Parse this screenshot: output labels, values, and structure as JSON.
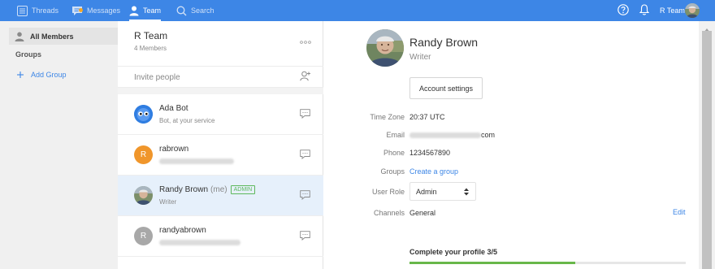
{
  "topbar": {
    "nav": [
      {
        "label": "Threads",
        "icon": "threads-icon"
      },
      {
        "label": "Messages",
        "icon": "messages-icon",
        "has_notification": true
      },
      {
        "label": "Team",
        "icon": "person-icon",
        "active": true
      },
      {
        "label": "Search",
        "icon": "search-icon"
      }
    ],
    "team_name": "R Team"
  },
  "sidebar": {
    "all_members": "All Members",
    "groups_heading": "Groups",
    "add_group": "Add Group"
  },
  "team": {
    "name": "R Team",
    "member_count": "4 Members",
    "invite_placeholder": "Invite people"
  },
  "members": [
    {
      "name": "Ada Bot",
      "subtitle": "Bot, at your service",
      "avatar_type": "bot"
    },
    {
      "name": "rabrown",
      "initial": "R",
      "avatar_color": "#f0962b",
      "subtitle_hidden": true
    },
    {
      "name": "Randy Brown",
      "me_label": "(me)",
      "admin_label": "ADMIN",
      "subtitle": "Writer",
      "avatar_type": "photo",
      "selected": true
    },
    {
      "name": "randyabrown",
      "initial": "R",
      "avatar_color": "#a8a8a8",
      "subtitle_hidden": true
    }
  ],
  "profile": {
    "name": "Randy Brown",
    "role": "Writer",
    "account_settings": "Account settings",
    "fields": {
      "time_zone_label": "Time Zone",
      "time_zone_value": "20:37 UTC",
      "email_label": "Email",
      "email_suffix": "com",
      "phone_label": "Phone",
      "phone_value": "1234567890",
      "groups_label": "Groups",
      "groups_link": "Create a group",
      "user_role_label": "User Role",
      "user_role_value": "Admin",
      "channels_label": "Channels",
      "channels_value": "General",
      "edit_label": "Edit"
    },
    "completion": {
      "title": "Complete your profile 3/5",
      "fraction": 0.6
    }
  },
  "colors": {
    "accent": "#3d86e6",
    "admin_badge": "#5cb85c",
    "progress": "#68b74a",
    "notification_dot": "#f5a623"
  }
}
